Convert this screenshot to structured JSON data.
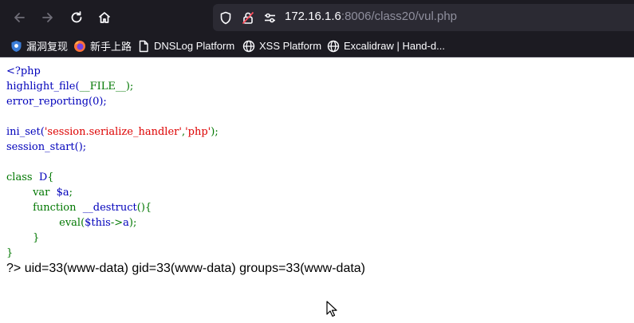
{
  "browser": {
    "url_host": "172.16.1.6",
    "url_rest": ":8006/class20/vul.php"
  },
  "bookmarks": [
    {
      "label": "漏洞复现",
      "icon": "shield-icon"
    },
    {
      "label": "新手上路",
      "icon": "firefox-icon"
    },
    {
      "label": "DNSLog Platform",
      "icon": "document-icon"
    },
    {
      "label": "XSS Platform",
      "icon": "globe-icon"
    },
    {
      "label": "Excalidraw | Hand-d...",
      "icon": "globe-icon"
    }
  ],
  "code": {
    "line1": "<?php",
    "line2a": "highlight_file(",
    "line2b": "__FILE__",
    "line2c": ");",
    "line3": "error_reporting(0);",
    "line5a": "ini_set(",
    "line5b": "'session.serialize_handler'",
    "line5c": ",",
    "line5d": "'php'",
    "line5e": ");",
    "line6": "session_start();",
    "line8a": "class",
    "line8b": "D",
    "line8c": "{",
    "line9a": "var",
    "line9b": "$a",
    "line9c": ";",
    "line10a": "function",
    "line10b": "__destruct",
    "line10c": "(){",
    "line11a": "eval(",
    "line11b": "$this",
    "line11c": "->",
    "line11d": "a",
    "line11e": ");",
    "line12": "}",
    "line13": "}"
  },
  "output": {
    "tag": "?>",
    "text": "uid=33(www-data) gid=33(www-data) groups=33(www-data)"
  },
  "colors": {
    "keyword": "#007700",
    "string": "#DD0000",
    "function": "#0000BB",
    "toolbar": "#1c1b22"
  }
}
